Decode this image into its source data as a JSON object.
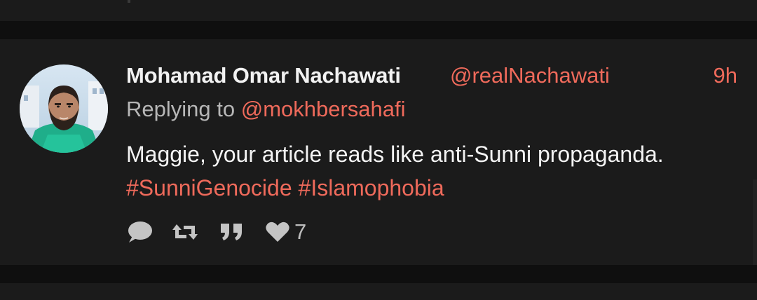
{
  "tweet": {
    "author_name": "Mohamad Omar Nachawati",
    "author_handle": "@realNachawati",
    "time": "9h",
    "reply_prefix": "Replying to",
    "reply_mention": "@mokhbersahafi",
    "body_line1": "Maggie, your article reads like anti-Sunni propaganda.",
    "hashtag1": "#SunniGenocide",
    "hashtag2": "#Islamophobia",
    "like_count": "7"
  },
  "icons": {
    "reply": "reply-icon",
    "retweet": "retweet-icon",
    "quote": "quote-icon",
    "like": "heart-icon"
  },
  "colors": {
    "background": "#1b1b1b",
    "separator": "#0f0f0f",
    "accent": "#ef6a5b",
    "primary_text": "#f4f4f4",
    "secondary_text": "#b7b7b7",
    "icon": "#c4c4c4"
  }
}
